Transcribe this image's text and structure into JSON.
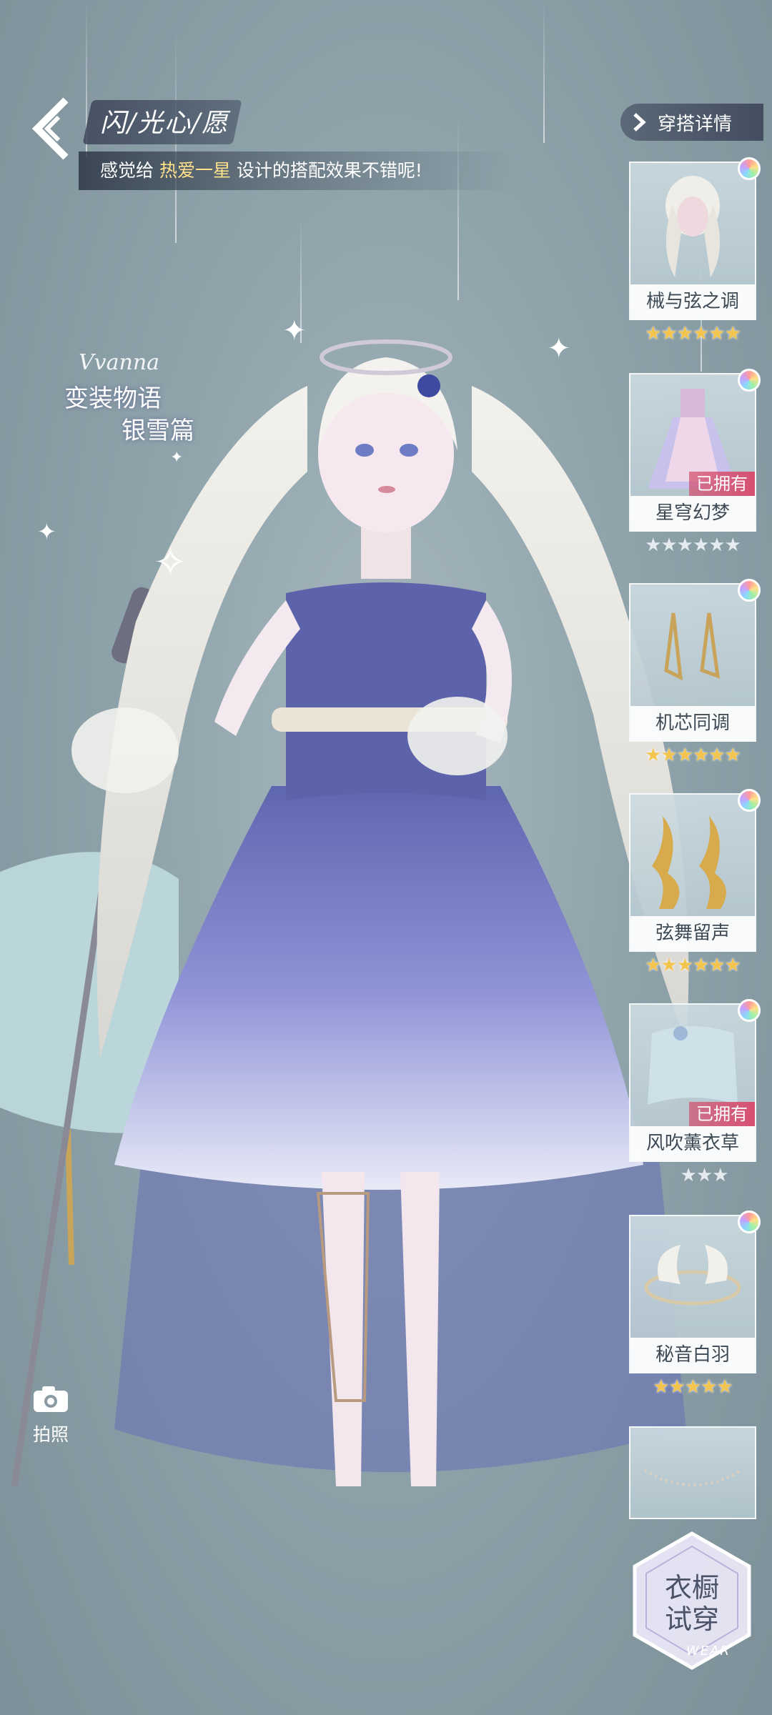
{
  "header": {
    "back_icon": "chevron-left-icon",
    "title": "闪/光心/愿",
    "comment_prefix": "感觉给 ",
    "comment_highlight": "热爱一星",
    "comment_suffix": " 设计的搭配效果不错呢!"
  },
  "event_logo": {
    "script": "Vvanna",
    "line1": "变装物语",
    "line2": "银雪篇"
  },
  "photo": {
    "label": "拍照",
    "icon": "camera-icon"
  },
  "side_panel": {
    "details_label": "穿搭详情",
    "items": [
      {
        "name": "械与弦之调",
        "owned_label": "",
        "stars": "★★★★★★",
        "star_color": "gold",
        "thumb": "hair-icon"
      },
      {
        "name": "星穹幻梦",
        "owned_label": "已拥有",
        "stars": "★★★★★★",
        "star_color": "silver",
        "thumb": "dress-icon"
      },
      {
        "name": "机芯同调",
        "owned_label": "",
        "stars": "★★★★★★",
        "star_color": "gold",
        "thumb": "earrings-icon"
      },
      {
        "name": "弦舞留声",
        "owned_label": "",
        "stars": "★★★★★★",
        "star_color": "gold",
        "thumb": "gold-earrings-icon"
      },
      {
        "name": "风吹薰衣草",
        "owned_label": "已拥有",
        "stars": "★★★",
        "star_color": "silver",
        "thumb": "veil-icon"
      },
      {
        "name": "秘音白羽",
        "owned_label": "",
        "stars": "★★★★★",
        "star_color": "gold",
        "thumb": "wing-headpiece-icon"
      },
      {
        "name": "",
        "owned_label": "",
        "stars": "",
        "star_color": "gold",
        "thumb": "necklace-icon"
      }
    ],
    "wardrobe_label_1": "衣橱",
    "wardrobe_label_2": "试穿",
    "wardrobe_sub": "WEAR"
  },
  "colors": {
    "accent_highlight": "#ffe08a",
    "owned_badge": "#d75072",
    "gold_star": "#f4c54e"
  }
}
